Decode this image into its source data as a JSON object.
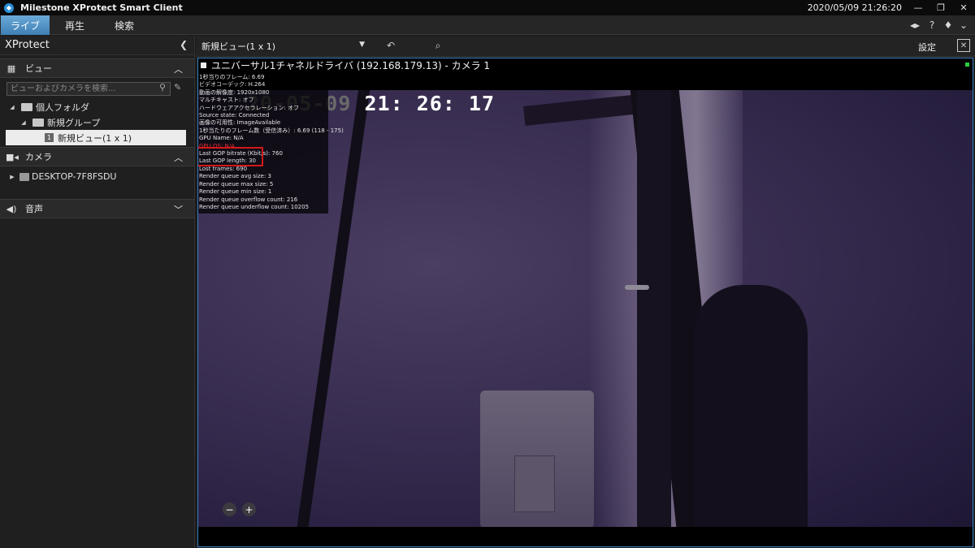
{
  "window": {
    "title": "Milestone XProtect Smart Client",
    "clock": "2020/05/09 21:26:20"
  },
  "tabs": [
    {
      "label": "ライブ",
      "active": true
    },
    {
      "label": "再生",
      "active": false
    },
    {
      "label": "検索",
      "active": false
    }
  ],
  "sidebar": {
    "title": "XProtect",
    "views_section": "ビュー",
    "search_placeholder": "ビューおよびカメラを検索...",
    "tree": {
      "personal_folder": "個人フォルダ",
      "group": "新規グループ",
      "view_badge": "1",
      "view": "新規ビュー(1 x 1)"
    },
    "cameras_section": "カメラ",
    "camera_host": "DESKTOP-7F8FSDU",
    "audio_section": "音声"
  },
  "view_toolbar": {
    "selected_view": "新規ビュー(1 x 1)",
    "settings_label": "設定"
  },
  "camera": {
    "title": "ユニバーサル1チャネルドライバ (192.168.179.13) - カメラ 1",
    "timestamp_date": "20-05-09",
    "timestamp_time": "21: 26: 17",
    "stats": [
      "1秒当りのフレーム: 6.69",
      "ビデオコーデック: H.264",
      "動画の解像度: 1920x1080",
      "マルチキャスト: オフ",
      "ハードウェアアクセラレーション: オフ",
      "Source state: Connected",
      "画像の可用性: ImageAvailable",
      "1秒当たりのフレーム数（受信済み）: 6.69 (118 - 175)",
      "GPU Name: N/A",
      "GPU OS: N/A",
      "Last GOP bitrate (Kbit/s): 760",
      "Last GOP length: 30",
      "Lost frames: 690",
      "Render queue avg size: 3",
      "Render queue max size: 5",
      "Render queue min size: 1",
      "Render queue overflow count: 216",
      "Render queue underflow count: 10205"
    ],
    "zoom_out": "−",
    "zoom_in": "+"
  },
  "colors": {
    "accent": "#3f7fb4",
    "tile_border": "#3a7fc1",
    "highlight": "#d11919",
    "live_indicator": "#2ecc40"
  }
}
